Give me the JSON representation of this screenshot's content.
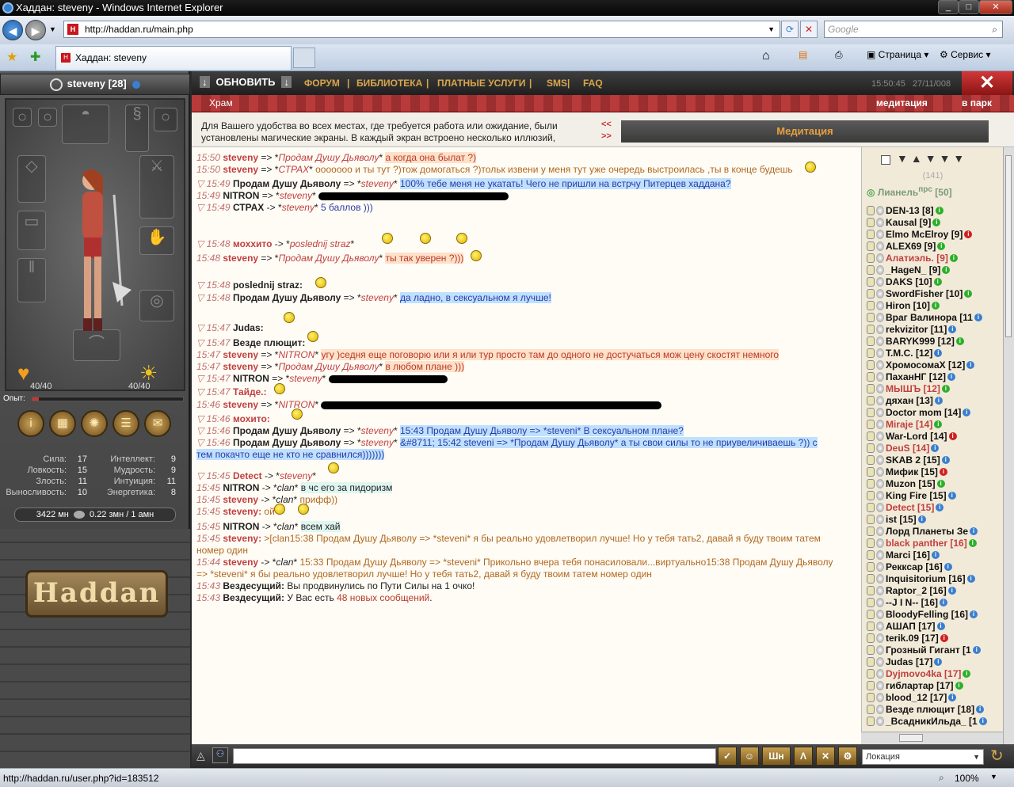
{
  "window": {
    "title": "Хаддан: steveny - Windows Internet Explorer",
    "min": "_",
    "max": "□",
    "close": "✕"
  },
  "address": {
    "url": "http://haddan.ru/main.php",
    "search_placeholder": "Google",
    "favicon": "H"
  },
  "tabs": {
    "active_label": "Хаддан: steveny"
  },
  "toolbar": {
    "page": "Страница",
    "service": "Сервис"
  },
  "game": {
    "char_name": "steveny [28]",
    "refresh": "ОБНОВИТЬ",
    "nav": [
      "ФОРУМ",
      "|",
      "БИБЛИОТЕКА",
      "|",
      "ПЛАТНЫЕ   УСЛУГИ",
      "|",
      "SMS",
      "|",
      "FAQ"
    ],
    "time": "15:50:45",
    "date": "27/11/008",
    "location": "Храм",
    "meditation_link": "медитация",
    "park_link": "в парк",
    "info_text": "Для Вашего удобства во всех местах, где требуется работа или ожидание, были установлены магические экраны. В каждый экран встроено несколько иллюзий,",
    "info_arrows": [
      "<<",
      ">>"
    ],
    "meditation_title": "Медитация",
    "hp": "40/40",
    "mp": "40/40",
    "exp_label": "Опыт:",
    "exp_fraction": 0.04,
    "stats_left": [
      [
        "Сила:",
        "17"
      ],
      [
        "Ловкость:",
        "15"
      ],
      [
        "Злость:",
        "11"
      ],
      [
        "Выносливость:",
        "10"
      ]
    ],
    "stats_right": [
      [
        "Интеллект:",
        "9"
      ],
      [
        "Мудрость:",
        "9"
      ],
      [
        "Интуиция:",
        "11"
      ],
      [
        "Энергетика:",
        "8"
      ]
    ],
    "money": "3422 мн",
    "money2": "0.22 змн / 1 амн",
    "logo": "Haddan",
    "location_select": "Локация"
  },
  "chat": [
    {
      "t": "15:50",
      "parts": [
        [
          "nk",
          "steveny"
        ],
        [
          "",
          " => *"
        ],
        [
          "ik",
          "Продам Душу Дьяволу"
        ],
        [
          "",
          "* "
        ],
        [
          "rd",
          "а когда она былат ?)"
        ]
      ]
    },
    {
      "t": "15:50",
      "parts": [
        [
          "nk",
          "steveny"
        ],
        [
          "",
          " => *"
        ],
        [
          "ik",
          "СТРАХ"
        ],
        [
          "",
          "* "
        ],
        [
          "pk",
          "ооооооо и ты тут ?)тож домогаться ?)тольк извени у меня тут уже очередь выстроилась ,ты в конце будешь"
        ]
      ]
    },
    {
      "t": "15:49",
      "tri": true,
      "parts": [
        [
          "nb",
          "Продам Душу Дьяволу"
        ],
        [
          "",
          " => *"
        ],
        [
          "ik",
          "steveny"
        ],
        [
          "",
          "* "
        ],
        [
          "bl",
          "100% тебе меня не укатать! Чего не пришли на встрчу Питерцев хаддана?"
        ]
      ]
    },
    {
      "t": "15:49",
      "parts": [
        [
          "nb",
          "NITRON"
        ],
        [
          "",
          " => *"
        ],
        [
          "ik",
          "steveny"
        ],
        [
          "",
          "* "
        ]
      ],
      "redact": 240
    },
    {
      "t": "15:49",
      "tri": true,
      "parts": [
        [
          "nb",
          "СТРАХ"
        ],
        [
          "",
          " -> *"
        ],
        [
          "ik",
          "steveny"
        ],
        [
          "",
          "* "
        ],
        [
          "bl2",
          "5 баллов )))"
        ]
      ]
    },
    {
      "t": "15:48",
      "tri": true,
      "parts": [
        [
          "nk",
          "моххито"
        ],
        [
          "",
          " -> *"
        ],
        [
          "ik",
          "poslednij straz"
        ],
        [
          "",
          "*"
        ]
      ]
    },
    {
      "t": "15:48",
      "parts": [
        [
          "nk",
          "steveny"
        ],
        [
          "",
          " => *"
        ],
        [
          "ik",
          "Продам Душу Дьяволу"
        ],
        [
          "",
          "* "
        ],
        [
          "rd",
          "ты так уверен ?)))"
        ]
      ]
    },
    {
      "t": "15:48",
      "tri": true,
      "parts": [
        [
          "nb",
          "poslednij straz:"
        ]
      ]
    },
    {
      "t": "15:48",
      "tri": true,
      "parts": [
        [
          "nb",
          "Продам Душу Дьяволу"
        ],
        [
          "",
          " => *"
        ],
        [
          "ik",
          "steveny"
        ],
        [
          "",
          "* "
        ],
        [
          "bl",
          "да ладно, в сексуальном я лучше!"
        ]
      ]
    },
    {
      "t": "15:47",
      "tri": true,
      "parts": [
        [
          "nb",
          "Judas:"
        ]
      ]
    },
    {
      "t": "15:47",
      "tri": true,
      "parts": [
        [
          "nb",
          "Везде плющит:"
        ]
      ]
    },
    {
      "t": "15:47",
      "parts": [
        [
          "nk",
          "steveny"
        ],
        [
          "",
          " => *"
        ],
        [
          "ik",
          "NITRON"
        ],
        [
          "",
          "* "
        ],
        [
          "rd",
          "угу )седня еще поговорю или я или тур просто там до одного не достучаться мож цену скостят немного"
        ]
      ]
    },
    {
      "t": "15:47",
      "parts": [
        [
          "nk",
          "steveny"
        ],
        [
          "",
          " => *"
        ],
        [
          "ik",
          "Продам Душу Дьяволу"
        ],
        [
          "",
          "* "
        ],
        [
          "rd",
          "в любом плане )))"
        ]
      ]
    },
    {
      "t": "15:47",
      "tri": true,
      "parts": [
        [
          "nb",
          "NITRON"
        ],
        [
          "",
          " => *"
        ],
        [
          "ik",
          "steveny"
        ],
        [
          "",
          "* "
        ]
      ],
      "redact": 150
    },
    {
      "t": "15:47",
      "tri": true,
      "parts": [
        [
          "nk",
          "Тайде.:"
        ]
      ]
    },
    {
      "t": "15:46",
      "parts": [
        [
          "nk",
          "steveny"
        ],
        [
          "",
          " => *"
        ],
        [
          "ik",
          "NITRON"
        ],
        [
          "",
          "* "
        ]
      ],
      "redact": 430
    },
    {
      "t": "15:46",
      "tri": true,
      "parts": [
        [
          "nk",
          "мохито:"
        ]
      ]
    },
    {
      "t": "15:46",
      "tri": true,
      "parts": [
        [
          "nb",
          "Продам Душу Дьяволу"
        ],
        [
          "",
          " => *"
        ],
        [
          "ik",
          "steveny"
        ],
        [
          "",
          "* "
        ],
        [
          "bl",
          "15:43 Продам Душу Дьяволу => *steveni* В сексуальном плане?"
        ]
      ]
    },
    {
      "t": "15:46",
      "tri": true,
      "parts": [
        [
          "nb",
          "Продам Душу Дьяволу"
        ],
        [
          "",
          " => *"
        ],
        [
          "ik",
          "steveny"
        ],
        [
          "",
          "* "
        ],
        [
          "bl",
          "&#8711; 15:42 steveni => *Продам Душу Дьяволу* а ты свои силы то не приувеличиваешь ?)) с"
        ]
      ]
    },
    {
      "t": "",
      "cont": true,
      "parts": [
        [
          "bl",
          "тем покачто еще не кто не сравнился)))))))"
        ]
      ]
    },
    {
      "t": "15:45",
      "tri": true,
      "parts": [
        [
          "nk",
          "Detect"
        ],
        [
          "",
          " -> *"
        ],
        [
          "ik",
          "steveny"
        ],
        [
          "",
          "*"
        ]
      ]
    },
    {
      "t": "15:45",
      "parts": [
        [
          "nb",
          "NITRON"
        ],
        [
          "",
          " -> *"
        ],
        [
          "ik2",
          "clan"
        ],
        [
          "",
          "* "
        ],
        [
          "cy",
          "в чс его за пидоризм"
        ]
      ]
    },
    {
      "t": "15:45",
      "parts": [
        [
          "nk",
          "steveny"
        ],
        [
          "",
          " -> *"
        ],
        [
          "ik2",
          "clan"
        ],
        [
          "",
          "* "
        ],
        [
          "pk",
          "прифф))"
        ]
      ]
    },
    {
      "t": "15:45",
      "parts": [
        [
          "nk",
          "steveny:"
        ],
        [
          "pk",
          " ой"
        ]
      ]
    },
    {
      "t": "15:45",
      "parts": [
        [
          "nb",
          "NITRON"
        ],
        [
          "",
          " -> *"
        ],
        [
          "ik2",
          "clan"
        ],
        [
          "",
          "* "
        ],
        [
          "cy",
          "всем хай"
        ]
      ]
    },
    {
      "t": "15:45",
      "parts": [
        [
          "nk",
          "steveny:"
        ],
        [
          "pk",
          " >[clan15:38 Продам Душу Дьяволу => *steveni* я бы реально удовлетворил лучше! Но у тебя тать2, давай я буду твоим татем"
        ]
      ]
    },
    {
      "t": "",
      "cont": true,
      "parts": [
        [
          "pk",
          "номер один"
        ]
      ]
    },
    {
      "t": "15:44",
      "parts": [
        [
          "nk",
          "steveny"
        ],
        [
          "",
          " -> *"
        ],
        [
          "ik2",
          "clan"
        ],
        [
          "",
          "* "
        ],
        [
          "pk",
          "15:33 Продам Душу Дьяволу => *steveni* Прикольно вчера тебя понасиловали...виртуально15:38 Продам Душу Дьяволу"
        ]
      ]
    },
    {
      "t": "",
      "cont": true,
      "parts": [
        [
          "pk",
          "=> *steveni* я бы реально удовлетворил лучше! Но у тебя тать2, давай я буду твоим татем номер один"
        ]
      ]
    },
    {
      "t": "15:43",
      "parts": [
        [
          "nb",
          "Вездесущий:"
        ],
        [
          "",
          " Вы продвинулись по Пути Силы на 1 очко!"
        ]
      ]
    },
    {
      "t": "15:43",
      "parts": [
        [
          "nb",
          "Вездесущий:"
        ],
        [
          "",
          " У Вас есть "
        ],
        [
          "rd2",
          "48 новых сообщений"
        ],
        [
          "",
          "."
        ]
      ]
    }
  ],
  "userlist": {
    "count": "(141)",
    "top_user": "Лианель",
    "top_user_sup": "прс",
    "top_user_level": " [50]",
    "users": [
      [
        "DEN-13 [8]",
        "g"
      ],
      [
        "Kausal [9]",
        "g"
      ],
      [
        "Elmo McElroy [9]",
        "r"
      ],
      [
        "ALEX69 [9]",
        "g"
      ],
      [
        "Алатиэль. [9]",
        "g"
      ],
      [
        "_HageN_ [9]",
        "g"
      ],
      [
        "DAKS [10]",
        "g"
      ],
      [
        "SwordFisher [10]",
        "g"
      ],
      [
        "Hiron [10]",
        "g"
      ],
      [
        "Враг Валинора [11",
        "b"
      ],
      [
        "rekvizitor [11]",
        "b"
      ],
      [
        "BARYK999 [12]",
        "g"
      ],
      [
        "Т.М.С. [12]",
        "b"
      ],
      [
        "ХромосомаX [12]",
        "b"
      ],
      [
        "ПаханНГ [12]",
        "b"
      ],
      [
        "МЫШЪ [12]",
        "g"
      ],
      [
        "дяхан [13]",
        "b"
      ],
      [
        "Doctor mom [14]",
        "b"
      ],
      [
        "Miraje [14]",
        "g"
      ],
      [
        "War-Lord [14]",
        "r"
      ],
      [
        "DeuS [14]",
        "b"
      ],
      [
        "SKAB 2 [15]",
        "b"
      ],
      [
        "Мифик [15]",
        "r"
      ],
      [
        "Muzon [15]",
        "g"
      ],
      [
        "King Fire [15]",
        "b"
      ],
      [
        "Detect [15]",
        "b"
      ],
      [
        "ist [15]",
        "b"
      ],
      [
        "Лорд Планеты Зе",
        "b"
      ],
      [
        "black panther [16]",
        "g"
      ],
      [
        "Marci [16]",
        "b"
      ],
      [
        "Реккcар [16]",
        "b"
      ],
      [
        "Inquisitorium [16]",
        "b"
      ],
      [
        "Raptor_2 [16]",
        "b"
      ],
      [
        "--J I N-- [16]",
        "b"
      ],
      [
        "BloodyFelling [16]",
        "b"
      ],
      [
        "АШАП [17]",
        "b"
      ],
      [
        "terik.09 [17]",
        "r"
      ],
      [
        "Грозный Гигант [1",
        "b"
      ],
      [
        "Judas [17]",
        "b"
      ],
      [
        "Dyjmovo4ka [17]",
        "g"
      ],
      [
        "гиблартар [17]",
        "g"
      ],
      [
        "blood_12 [17]",
        "b"
      ],
      [
        "Везде плющит [18]",
        "b"
      ],
      [
        "_ВсадникИльда_ [1",
        "b"
      ]
    ]
  },
  "status": {
    "url": "http://haddan.ru/user.php?id=183512",
    "zoom": "100%"
  }
}
